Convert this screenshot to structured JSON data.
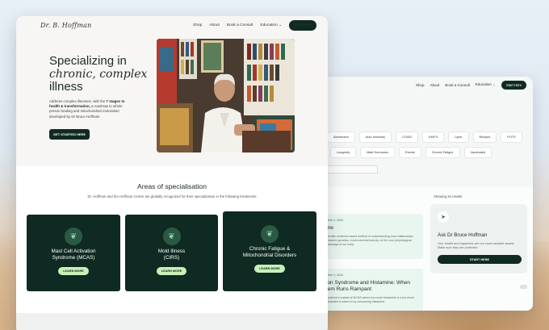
{
  "back_window": {
    "nav": {
      "items": [
        "Shop",
        "About",
        "Book a Consult",
        "Education"
      ],
      "start": "Start Here"
    },
    "topic_chips_row1": [
      "",
      "Alzheimers",
      "Auto Immunity",
      "COVID",
      "EMF'S",
      "Lyme",
      "Recipes",
      "POTS"
    ],
    "topic_chips_row2": [
      "",
      "Longevity",
      "Male Hormones",
      "Events",
      "Chronic Fatigue",
      "Vaccinated"
    ],
    "showing": "Showing 34 results",
    "post1": {
      "date": "mber 1, 2024",
      "title": "me",
      "text": "cientific evidence based method of understanding how relationships between genetics, environmental toxicity, nd the core physiological pathways of our body."
    },
    "post2": {
      "date": "mber 1, 2024",
      "title": "ion Syndrome and Histamine: When tem Runs Rampant",
      "text": "nsidered a subset of MCAS where too much histamine is a too much histamine is taken in by consuming histamine-"
    },
    "ask": {
      "title": "Ask Dr Bruce Hoffman",
      "text": "Your health and happiness are our most valuable assets. Make sure they are protected.",
      "button": "START HERE"
    }
  },
  "front_window": {
    "logo": "Dr. B. Hoffman",
    "nav": {
      "items": [
        "Shop",
        "About",
        "Book a Consult",
        "Education"
      ],
      "start": "Start Here"
    },
    "hero": {
      "title_line1": "Specializing in",
      "title_italic": "chronic, complex",
      "title_line3": "illness",
      "text_before": "Address complex illnesses, with the ",
      "text_bold": "7 stages to health & transformation,",
      "text_after": " a roadmap to whole person healing and mitochondrial restoration developed by Dr Bruce Hoffman",
      "button": "GET STARTED HERE"
    },
    "section": {
      "title": "Areas of specialisation",
      "subtitle": "Dr. Hoffman and the Hoffman Centre are globally recognized for their specialization in the following treatments",
      "cards": [
        {
          "title": "Mast Cell Activation Syndrome (MCAS)",
          "button": "LEARN MORE"
        },
        {
          "title": "Mold Illness (CIRS)",
          "button": "LEARN MORE"
        },
        {
          "title": "Chronic Fatigue & Mitochondrial Disorders",
          "button": "LEARN MORE"
        }
      ]
    }
  },
  "colors": {
    "primary": "#0f2a22",
    "accent": "#c9f0b8",
    "card_bg": "#e9f6ef"
  }
}
